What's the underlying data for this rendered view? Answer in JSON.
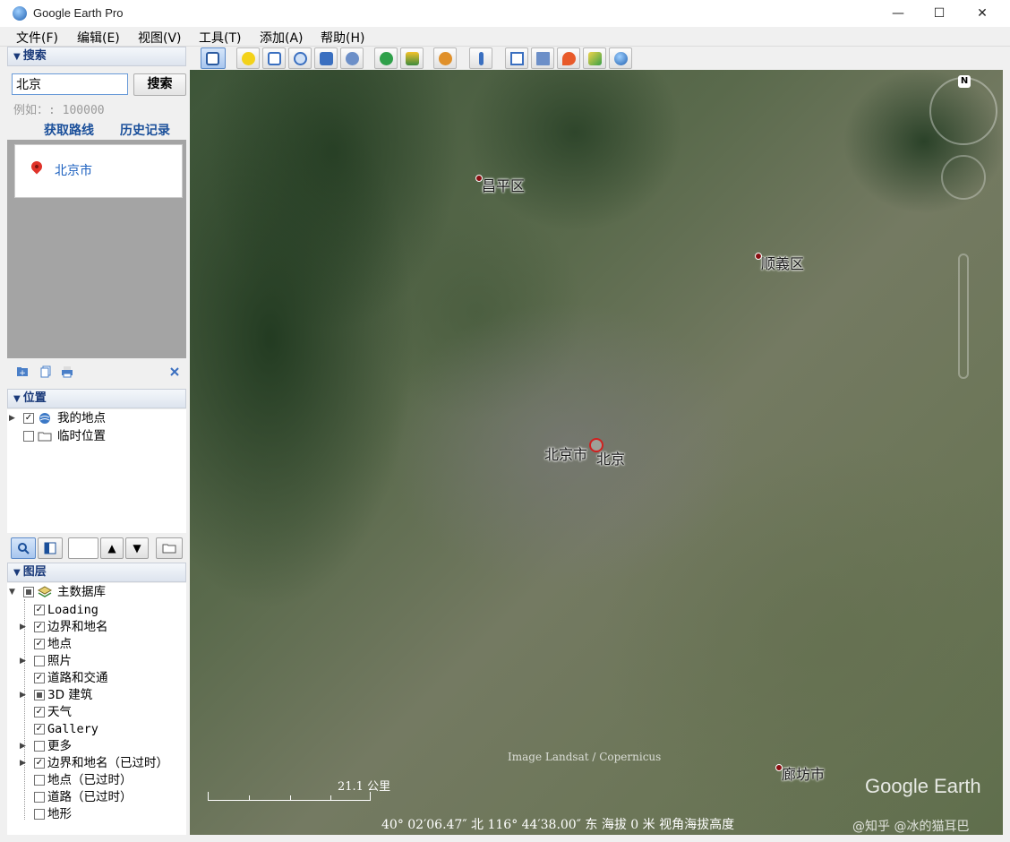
{
  "window": {
    "title": "Google Earth Pro",
    "minimize": "—",
    "maximize": "☐",
    "close": "✕"
  },
  "menu": [
    "文件(F)",
    "编辑(E)",
    "视图(V)",
    "工具(T)",
    "添加(A)",
    "帮助(H)"
  ],
  "search": {
    "header": "搜索",
    "value": "北京",
    "button": "搜索",
    "hint": "例如：: 100000",
    "directions_link": "获取路线",
    "history_link": "历史记录",
    "result": "北京市"
  },
  "places": {
    "header": "位置",
    "items": [
      {
        "label": "我的地点",
        "checked": true
      },
      {
        "label": "临时位置",
        "checked": false
      }
    ]
  },
  "layers": {
    "header": "图层",
    "root": "主数据库",
    "items": [
      {
        "label": "Loading",
        "checked": true
      },
      {
        "label": "边界和地名",
        "checked": true
      },
      {
        "label": "地点",
        "checked": true
      },
      {
        "label": "照片",
        "checked": false
      },
      {
        "label": "道路和交通",
        "checked": true
      },
      {
        "label": "3D 建筑",
        "checked": "partial"
      },
      {
        "label": "天气",
        "checked": true
      },
      {
        "label": "Gallery",
        "checked": true
      },
      {
        "label": "更多",
        "checked": false
      },
      {
        "label": "边界和地名（已过时）",
        "checked": true
      },
      {
        "label": "地点（已过时）",
        "checked": false
      },
      {
        "label": "道路（已过时）",
        "checked": false
      },
      {
        "label": "地形",
        "checked": false
      }
    ]
  },
  "map": {
    "labels": {
      "changping": "昌平区",
      "shunyi": "顺義区",
      "beijing_city": "北京市",
      "beijing": "北京",
      "langfang": "廊坊市"
    },
    "attribution": "Image Landsat / Copernicus",
    "logo": "Google Earth",
    "scale": "21.1 公里",
    "status": "40° 02′06.47″ 北 116° 44′38.00″ 东 海拔      0 米   视角海拔高度",
    "watermark": "@知乎 @冰的猫耳巴",
    "compass_n": "N"
  },
  "colors": {
    "accent": "#1a4f9a",
    "link": "#1a5fbf",
    "pin": "#e0332a"
  }
}
